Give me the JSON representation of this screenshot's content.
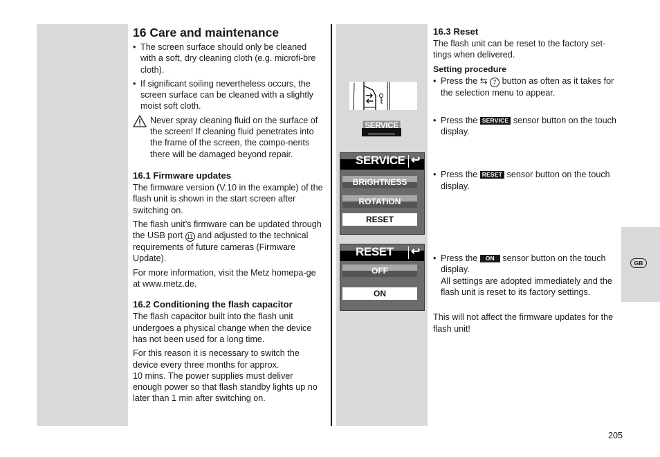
{
  "section16": {
    "title": "16 Care and maintenance",
    "bullets": [
      "The screen surface should only be cleaned with a soft, dry cleaning cloth (e.g. microfi-bre cloth).",
      "If significant soiling nevertheless occurs, the screen surface can be cleaned with a slightly moist soft cloth."
    ],
    "warning": "Never spray cleaning fluid on the surface of the screen! If cleaning fluid penetrates into the frame of the screen, the compo-nents there will be damaged beyond repair."
  },
  "section16_1": {
    "title": "16.1 Firmware updates",
    "p1": "The firmware version (V.10 in the example) of the flash unit is shown in the start screen after switching on.",
    "p2_before": "The flash unit’s firmware can be updated through the USB port ",
    "p2_ref": "11",
    "p2_after": " and adjusted to the technical requirements of future cameras (Firmware Update).",
    "p3": "For more information, visit the Metz homepa-ge at www.metz.de."
  },
  "section16_2": {
    "title": "16.2 Conditioning the flash capacitor",
    "p1": "The flash capacitor built into the flash unit undergoes a physical change when the device has not been used for a long time.",
    "p2": "For this reason it is necessary to switch the device every three months for approx.",
    "p3": "10 mins. The power supplies must deliver enough power so that flash standby lights up no later than 1 min after switching on."
  },
  "section16_3": {
    "title": "16.3 Reset",
    "intro": "The flash unit can be reset to the factory set-tings when delivered.",
    "procedure_title": "Setting procedure",
    "step1_before": "Press the ",
    "step1_arrows": "⇆",
    "step1_ref": "7",
    "step1_after": " button as often as it takes for the selection menu to appear.",
    "step2_before": "Press the ",
    "step2_badge": "SERVICE",
    "step2_after": " sensor button on the touch display.",
    "step3_before": "Press the ",
    "step3_badge": "RESET",
    "step3_after": " sensor button on the touch display.",
    "step4_before": "Press the ",
    "step4_badge": "ON",
    "step4_after": " sensor button on the touch display.",
    "step4_extra": "All settings are adopted immediately and the flash unit is reset to its factory settings.",
    "note": "This will not affect the firmware updates for the flash unit!"
  },
  "illustrations": {
    "service_key_label": "SERVICE",
    "service_screen": {
      "title": "SERVICE",
      "back_icon": "↩",
      "items": [
        "BRIGHTNESS",
        "ROTATION",
        "RESET"
      ],
      "selected": "RESET"
    },
    "reset_screen": {
      "title": "RESET",
      "back_icon": "↩",
      "items": [
        "OFF",
        "ON"
      ],
      "selected": "ON"
    }
  },
  "language_tab": "GB",
  "page_number": "205"
}
